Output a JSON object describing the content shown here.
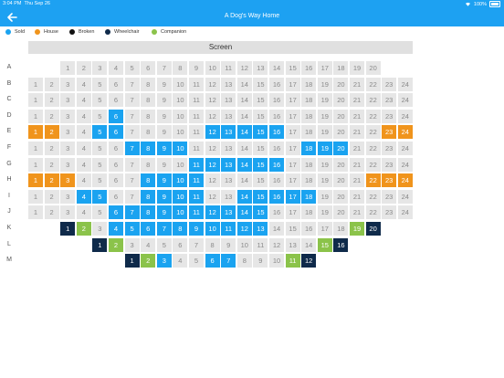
{
  "status": {
    "time": "3:04 PM",
    "date": "Thu Sep 26",
    "battery": "100%"
  },
  "nav": {
    "title": "A Dog's Way Home"
  },
  "legend": [
    {
      "label": "Sold",
      "color": "#1aa3f0"
    },
    {
      "label": "House",
      "color": "#f0941c"
    },
    {
      "label": "Broken",
      "color": "#111111"
    },
    {
      "label": "Wheelchair",
      "color": "#0f2a4a"
    },
    {
      "label": "Companion",
      "color": "#8bc34a"
    }
  ],
  "screen_label": "Screen",
  "rows": [
    {
      "label": "A",
      "start": 3,
      "first": 1,
      "count": 20,
      "statuses": {}
    },
    {
      "label": "B",
      "start": 1,
      "first": 1,
      "count": 24,
      "statuses": {}
    },
    {
      "label": "C",
      "start": 1,
      "first": 1,
      "count": 24,
      "statuses": {}
    },
    {
      "label": "D",
      "start": 1,
      "first": 1,
      "count": 24,
      "statuses": {
        "6": "sold"
      }
    },
    {
      "label": "E",
      "start": 1,
      "first": 1,
      "count": 24,
      "statuses": {
        "1": "house",
        "2": "house",
        "5": "sold",
        "6": "sold",
        "12": "sold",
        "13": "sold",
        "14": "sold",
        "15": "sold",
        "16": "sold",
        "23": "house",
        "24": "house"
      }
    },
    {
      "label": "F",
      "start": 1,
      "first": 1,
      "count": 24,
      "statuses": {
        "7": "sold",
        "8": "sold",
        "9": "sold",
        "10": "sold",
        "18": "sold",
        "19": "sold",
        "20": "sold"
      }
    },
    {
      "label": "G",
      "start": 1,
      "first": 1,
      "count": 24,
      "statuses": {
        "11": "sold",
        "12": "sold",
        "13": "sold",
        "14": "sold",
        "15": "sold",
        "16": "sold"
      }
    },
    {
      "label": "H",
      "start": 1,
      "first": 1,
      "count": 24,
      "statuses": {
        "1": "house",
        "2": "house",
        "3": "house",
        "8": "sold",
        "9": "sold",
        "10": "sold",
        "11": "sold",
        "22": "house",
        "23": "house",
        "24": "house"
      }
    },
    {
      "label": "I",
      "start": 1,
      "first": 1,
      "count": 24,
      "statuses": {
        "4": "sold",
        "5": "sold",
        "8": "sold",
        "9": "sold",
        "10": "sold",
        "11": "sold",
        "14": "sold",
        "15": "sold",
        "16": "sold",
        "17": "sold",
        "18": "sold"
      }
    },
    {
      "label": "J",
      "start": 1,
      "first": 1,
      "count": 24,
      "statuses": {
        "6": "sold",
        "7": "sold",
        "8": "sold",
        "9": "sold",
        "10": "sold",
        "11": "sold",
        "12": "sold",
        "13": "sold",
        "14": "sold",
        "15": "sold"
      }
    },
    {
      "label": "K",
      "start": 3,
      "first": 1,
      "count": 20,
      "statuses": {
        "1": "wheelchair",
        "2": "companion",
        "4": "sold",
        "5": "sold",
        "6": "sold",
        "7": "sold",
        "8": "sold",
        "9": "sold",
        "10": "sold",
        "11": "sold",
        "12": "sold",
        "13": "sold",
        "19": "companion",
        "20": "wheelchair"
      }
    },
    {
      "label": "L",
      "start": 5,
      "first": 1,
      "count": 16,
      "statuses": {
        "1": "wheelchair",
        "2": "companion",
        "15": "companion",
        "16": "wheelchair"
      }
    },
    {
      "label": "M",
      "start": 7,
      "first": 1,
      "count": 12,
      "statuses": {
        "1": "wheelchair",
        "2": "companion",
        "3": "sold",
        "6": "sold",
        "7": "sold",
        "11": "companion",
        "12": "wheelchair"
      }
    }
  ]
}
